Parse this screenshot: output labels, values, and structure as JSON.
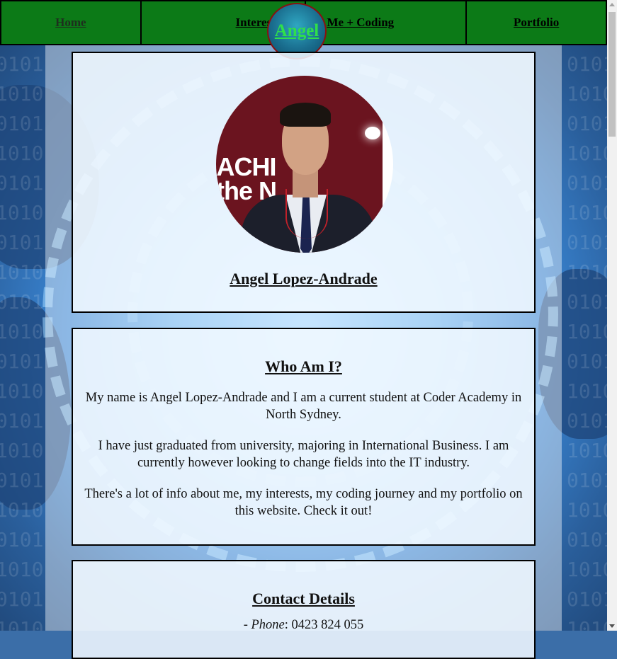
{
  "nav": {
    "home": "Home",
    "interests": "Interests",
    "logo": "Angel",
    "coding": "Me + Coding",
    "portfolio": "Portfolio"
  },
  "profile": {
    "photo_sign": "ACHI\nthe N",
    "name": "Angel Lopez-Andrade"
  },
  "about": {
    "heading": "Who Am I?",
    "paragraphs": [
      "My name is Angel Lopez-Andrade and I am a current student at Coder Academy in North Sydney.",
      "I have just graduated from university, majoring in International Business. I am currently however looking to change fields into the IT industry.",
      "There's a lot of info about me, my interests, my coding journey and my portfolio on this website. Check it out!"
    ]
  },
  "contact": {
    "heading": "Contact Details",
    "phone_prefix": "- ",
    "phone_label": "Phone",
    "phone_value": ": 0423 824 055"
  },
  "background": {
    "binary": "0101\n1010\n0101\n1010\n0101\n1010\n0101\n1010\n0101\n1010\n0101\n1010\n0101\n1010\n0101\n1010\n0101\n1010\n0101\n1010\n0101"
  },
  "colors": {
    "nav_bg": "#0c7a17",
    "logo_text": "#2fe04a",
    "logo_border": "#8a1010"
  }
}
